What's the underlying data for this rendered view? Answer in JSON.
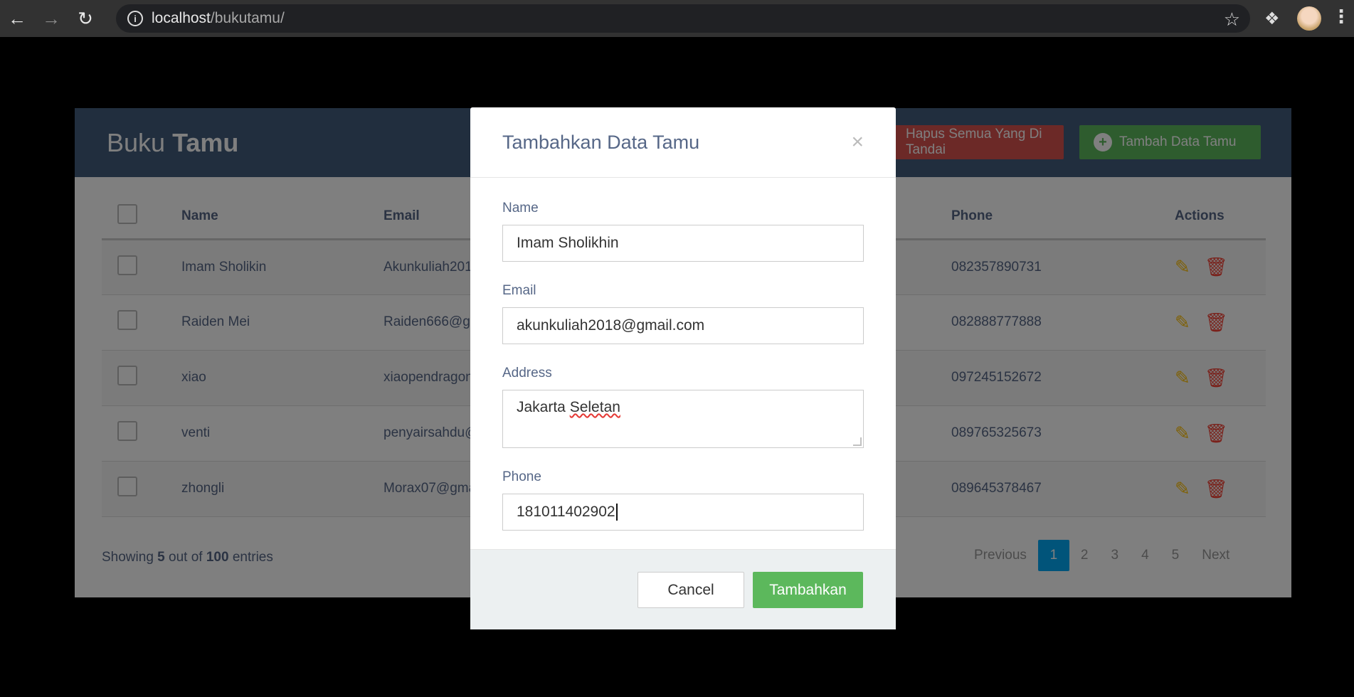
{
  "browser": {
    "url_host": "localhost",
    "url_path": "/bukutamu/"
  },
  "header": {
    "title_light": "Buku ",
    "title_bold": "Tamu",
    "delete_button": "Hapus Semua Yang Di Tandai",
    "add_button": "Tambah Data Tamu"
  },
  "table": {
    "columns": [
      "Name",
      "Email",
      "Phone",
      "Actions"
    ],
    "rows": [
      {
        "name": "Imam Sholikin",
        "email": "Akunkuliah2018@gmail.com",
        "phone": "082357890731"
      },
      {
        "name": "Raiden Mei",
        "email": "Raiden666@gmail.com",
        "phone": "082888777888"
      },
      {
        "name": "xiao",
        "email": "xiaopendragon@gmail.com",
        "phone": "097245152672"
      },
      {
        "name": "venti",
        "email": "penyairsahdu@gmail.com",
        "phone": "089765325673"
      },
      {
        "name": "zhongli",
        "email": "Morax07@gmail.com",
        "phone": "089645378467"
      }
    ]
  },
  "footer": {
    "showing_prefix": "Showing ",
    "showing_count": "5",
    "showing_mid": " out of ",
    "showing_total": "100",
    "showing_suffix": " entries",
    "pagination": {
      "previous": "Previous",
      "pages": [
        "1",
        "2",
        "3",
        "4",
        "5"
      ],
      "next": "Next",
      "active": "1"
    }
  },
  "modal": {
    "title": "Tambahkan Data Tamu",
    "close": "×",
    "fields": {
      "name_label": "Name",
      "name_value": "Imam Sholikhin",
      "email_label": "Email",
      "email_value": "akunkuliah2018@gmail.com",
      "address_label": "Address",
      "address_word1": "Jakarta ",
      "address_word2": "Seletan",
      "phone_label": "Phone",
      "phone_value": "181011402902"
    },
    "cancel": "Cancel",
    "submit": "Tambahkan"
  }
}
